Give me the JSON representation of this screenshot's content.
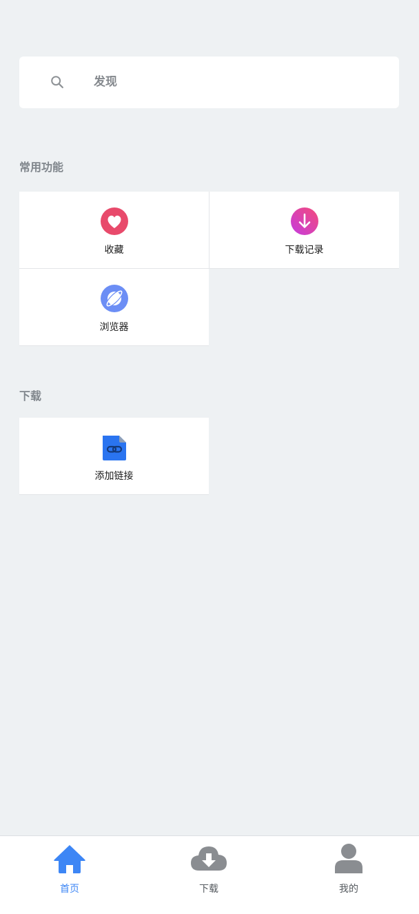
{
  "search": {
    "text": "发现",
    "icon": "search-icon"
  },
  "sections": {
    "common": {
      "title": "常用功能",
      "items": [
        {
          "label": "收藏",
          "icon": "heart-icon",
          "color": "#e84a6b"
        },
        {
          "label": "下载记录",
          "icon": "download-arrow-icon",
          "color": "#e8408f"
        },
        {
          "label": "浏览器",
          "icon": "browser-planet-icon",
          "color": "#6c8ef5"
        }
      ]
    },
    "download": {
      "title": "下载",
      "items": [
        {
          "label": "添加链接",
          "icon": "link-file-icon",
          "color": "#2a74f0"
        }
      ]
    }
  },
  "tabbar": {
    "tabs": [
      {
        "label": "首页",
        "icon": "home-icon",
        "active": true
      },
      {
        "label": "下载",
        "icon": "cloud-download-icon",
        "active": false
      },
      {
        "label": "我的",
        "icon": "user-icon",
        "active": false
      }
    ],
    "active_color": "#3d86f5",
    "inactive_color": "#8a8d91"
  }
}
